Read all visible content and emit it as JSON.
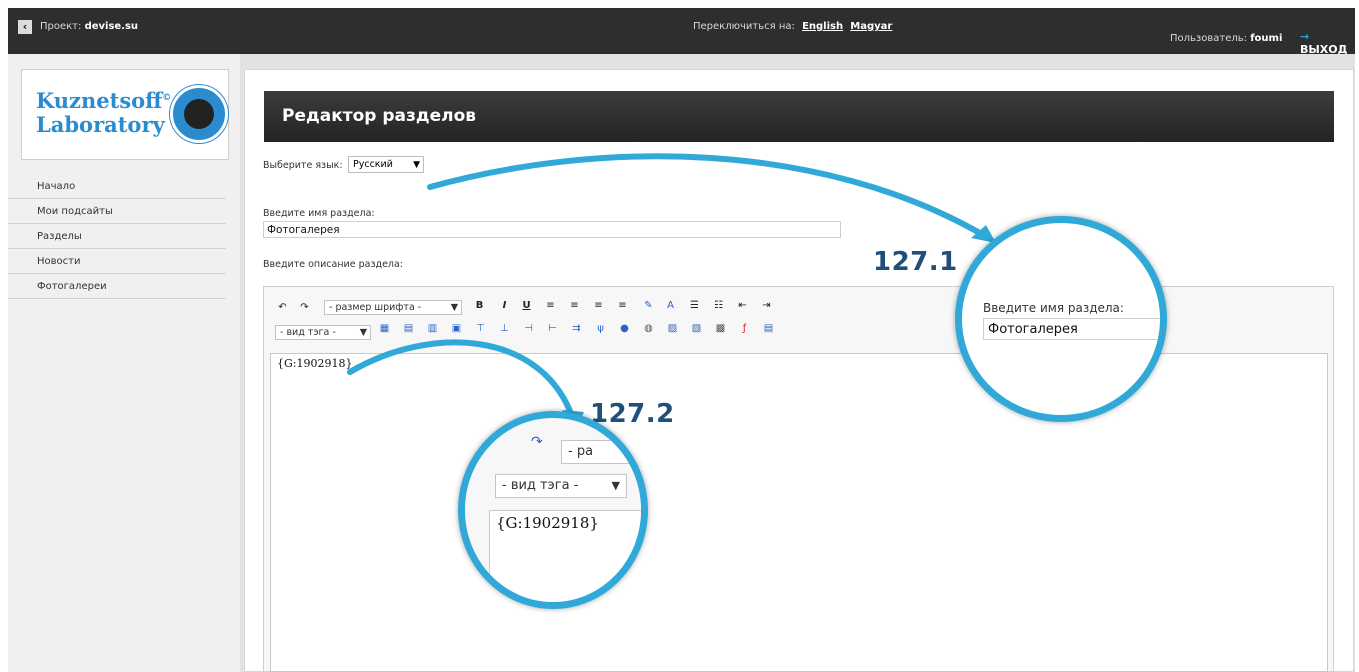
{
  "topbar": {
    "back_icon": "chevron-left-icon",
    "project_label": "Проект:",
    "project_name": "devise.su",
    "switch_label": "Переключиться на:",
    "lang_links": [
      "English",
      "Magyar"
    ],
    "user_label": "Пользователь:",
    "user_name": "foumi",
    "logout_label": "ВЫХОД",
    "logout_icon": "arrow-right-icon"
  },
  "logo": {
    "line1": "Kuznetsoff",
    "sup": "©",
    "line2": "Laboratory"
  },
  "sidebar": {
    "items": [
      {
        "label": "Начало"
      },
      {
        "label": "Мои подсайты"
      },
      {
        "label": "Разделы"
      },
      {
        "label": "Новости"
      },
      {
        "label": "Фотогалереи"
      }
    ]
  },
  "main": {
    "title": "Редактор разделов",
    "lang_label": "Выберите язык:",
    "lang_value": "Русский",
    "name_label": "Введите имя раздела:",
    "name_value": "Фотогалерея",
    "desc_label": "Введите описание раздела:"
  },
  "editor": {
    "font_size_placeholder": "- размер шрифта -",
    "tag_placeholder": "- вид тэга -",
    "content": "{G:1902918}",
    "toolbar_row1": [
      "undo-icon",
      "redo-icon",
      "bold-icon",
      "italic-icon",
      "underline-icon",
      "align-left-icon",
      "align-center-icon",
      "align-right-icon",
      "align-justify-icon",
      "text-color-icon",
      "font-color-icon",
      "bullet-list-icon",
      "numbered-list-icon",
      "outdent-icon",
      "indent-icon"
    ],
    "toolbar_row2": [
      "table-icon",
      "edit-table-icon",
      "table-props-icon",
      "image-icon",
      "insert-row-above-icon",
      "insert-row-below-icon",
      "insert-col-left-icon",
      "insert-col-right-icon",
      "merge-cells-icon",
      "split-cells-icon",
      "link-icon",
      "unlink-icon",
      "insert-image-icon",
      "gallery-icon",
      "template-icon",
      "flash-icon",
      "save-icon"
    ]
  },
  "callouts": [
    {
      "number": "127.1",
      "label": "Введите имя раздела:",
      "value": "Фотогалерея"
    },
    {
      "number": "127.2",
      "tag_placeholder": "- вид тэга -",
      "font_partial": "- ра",
      "content": "{G:1902918}"
    }
  ],
  "colors": {
    "topbar": "#2e2e2e",
    "header": "#2b2b2b",
    "accent": "#31a9d8",
    "callout_number": "#1f4f7a",
    "logo": "#2a8ccf"
  }
}
